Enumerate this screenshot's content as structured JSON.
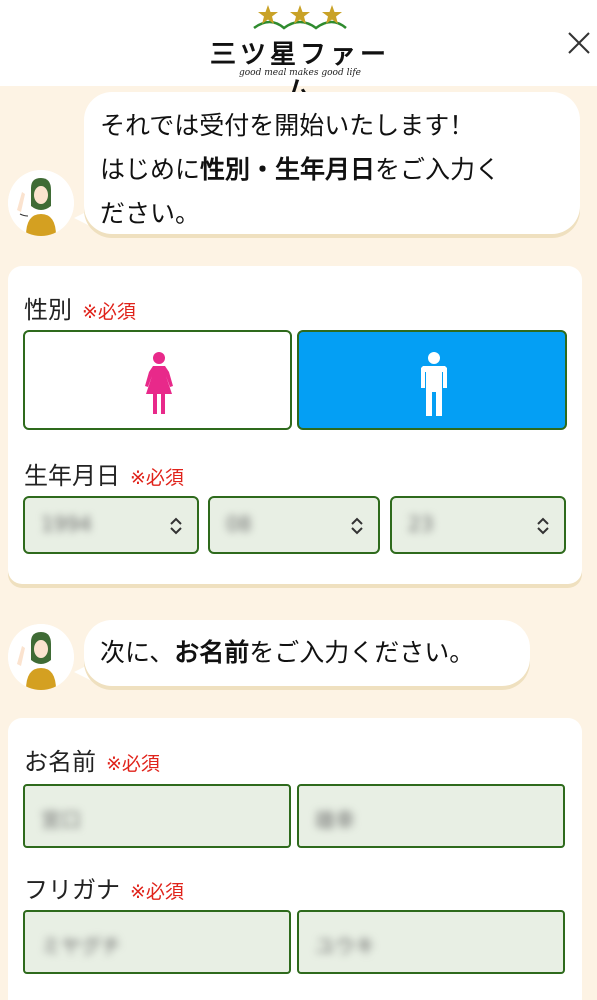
{
  "header": {
    "logo_title": "三ツ星ファーム",
    "logo_tagline": "good meal makes good life",
    "close_icon": "close-icon",
    "brand_colors": {
      "star": "#c9a227",
      "leaf": "#2e8b2e"
    }
  },
  "chat1": {
    "line1": "それでは受付を開始いたします！",
    "line2_pre": "はじめに",
    "line2_bold": "性別・生年月日",
    "line2_post": "をご入力く",
    "line3": "ださい。"
  },
  "gender": {
    "label": "性別",
    "required": "※必須",
    "options": [
      {
        "value": "female",
        "icon": "female-icon",
        "selected": false
      },
      {
        "value": "male",
        "icon": "male-icon",
        "selected": true
      }
    ]
  },
  "birthdate": {
    "label": "生年月日",
    "required": "※必須",
    "year": "1994",
    "month": "08",
    "day": "23"
  },
  "chat2": {
    "pre": "次に、",
    "bold": "お名前",
    "post": "をご入力ください。"
  },
  "name": {
    "label": "お名前",
    "required": "※必須",
    "last": "宮口",
    "first": "雄幸"
  },
  "furigana": {
    "label": "フリガナ",
    "required": "※必須",
    "last": "ミヤグチ",
    "first": "ユウキ"
  },
  "colors": {
    "accent_blue": "#049ff4",
    "female_pink": "#e8298a",
    "border_green": "#2e6a1c",
    "required_red": "#e0231b",
    "background": "#fdf3e4"
  }
}
